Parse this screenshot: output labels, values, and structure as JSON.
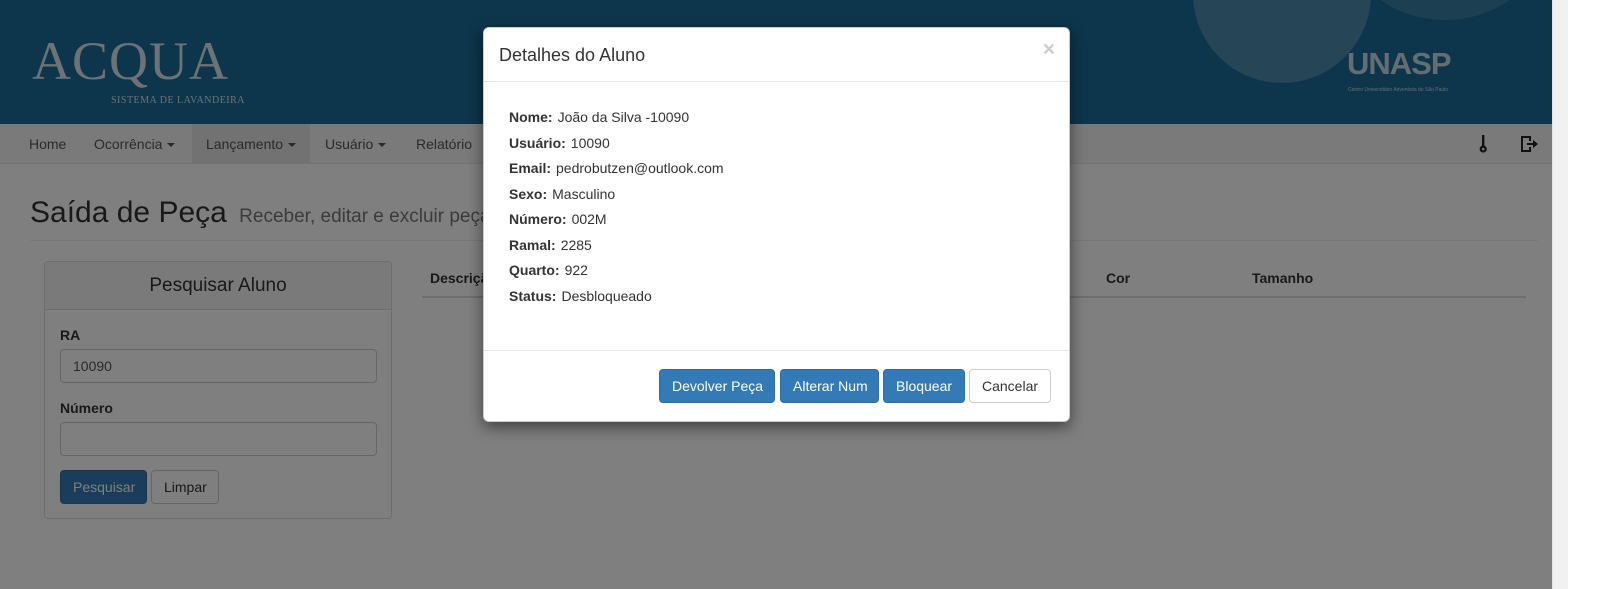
{
  "header": {
    "logo_text": "ACQUA",
    "logo_subtitle": "SISTEMA DE LAVANDEIRA",
    "brand_text": "UNASP",
    "brand_subtitle": "Centro Universitário Adventista de São Paulo"
  },
  "navbar": {
    "items": [
      {
        "label": "Home",
        "dropdown": false
      },
      {
        "label": "Ocorrência",
        "dropdown": true
      },
      {
        "label": "Lançamento",
        "dropdown": true
      },
      {
        "label": "Usuário",
        "dropdown": true
      },
      {
        "label": "Relatório",
        "dropdown": false
      }
    ],
    "icons": [
      "key-icon",
      "logout-icon"
    ]
  },
  "page": {
    "title": "Saída de Peça",
    "subtitle": "Receber, editar e excluir peça"
  },
  "search_panel": {
    "heading": "Pesquisar Aluno",
    "ra_label": "RA",
    "ra_value": "10090",
    "numero_label": "Número",
    "numero_value": "",
    "search_button": "Pesquisar",
    "clear_button": "Limpar"
  },
  "table": {
    "columns": [
      "Descrição",
      "Cor",
      "Tamanho"
    ]
  },
  "modal": {
    "title": "Detalhes do Aluno",
    "close_symbol": "×",
    "details": [
      {
        "label": "Nome:",
        "value": "João da Silva -10090"
      },
      {
        "label": "Usuário:",
        "value": "10090"
      },
      {
        "label": "Email:",
        "value": "pedrobutzen@outlook.com"
      },
      {
        "label": "Sexo:",
        "value": "Masculino"
      },
      {
        "label": "Número:",
        "value": "002M"
      },
      {
        "label": "Ramal:",
        "value": "2285"
      },
      {
        "label": "Quarto:",
        "value": "922"
      },
      {
        "label": "Status:",
        "value": "Desbloqueado"
      }
    ],
    "buttons": {
      "return": "Devolver Peça",
      "change_num": "Alterar Num",
      "block": "Bloquear",
      "cancel": "Cancelar"
    }
  },
  "colors": {
    "header_bg": "#1b6b96",
    "primary": "#337ab7",
    "backdrop": "rgba(0,0,0,0.5)"
  }
}
